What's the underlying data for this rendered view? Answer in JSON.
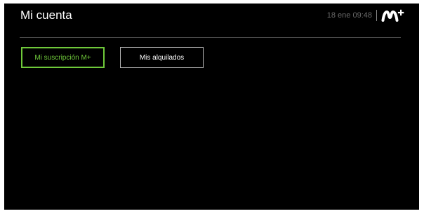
{
  "header": {
    "title": "Mi cuenta",
    "datetime": "18 ene 09:48",
    "logo": {
      "icon": "movistar-m-plus-logo",
      "text": "M+"
    }
  },
  "tabs": [
    {
      "label": "Mi suscripción M+",
      "selected": true
    },
    {
      "label": "Mis alquilados",
      "selected": false
    }
  ],
  "colors": {
    "background": "#000000",
    "accent": "#6fc93a",
    "text": "#ffffff",
    "muted": "#6a6a6a"
  }
}
